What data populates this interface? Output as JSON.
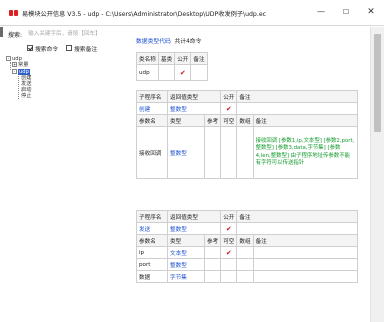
{
  "window": {
    "title": "易模块公开信息 V3.5 - udp - C:\\Users\\Administrator\\Desktop\\UDP收发例子\\udp.ec",
    "minimize": "—",
    "maximize": "☐",
    "close": "✕"
  },
  "search": {
    "label": "搜索:",
    "placeholder": "输入关键字后，请按【回车】"
  },
  "options": {
    "search_commands": "搜索命令",
    "search_comments": "搜索备注"
  },
  "tree": {
    "root": "udp",
    "child": "常量",
    "selected": "udp",
    "items": [
      "创建",
      "发送",
      "启动",
      "停止"
    ]
  },
  "summary": {
    "link": "数据类型代码",
    "count": "共计4命令"
  },
  "class_table": {
    "headers": [
      "类名称",
      "基类",
      "公开",
      "备注"
    ],
    "row": {
      "name": "udp",
      "base": "",
      "public": "✔",
      "note": ""
    }
  },
  "sub1": {
    "headers": [
      "子程序名",
      "返回值类型",
      "公开",
      "备注"
    ],
    "row": {
      "name": "创建",
      "return_type": "整数型",
      "public": "✔",
      "note": ""
    },
    "param_headers": [
      "参数名",
      "类型",
      "参考",
      "可空",
      "数组",
      "备注"
    ],
    "param_row": {
      "name": "接收回调",
      "type": "整数型",
      "note": "接收回调 [参数1,ip,文本型] [参数2,port,整数型] [参数3,data,字节集] [参数4,len,整数型] 由子程序地址传参数不能有字符可以传送指针"
    }
  },
  "sub2": {
    "headers": [
      "子程序名",
      "返回值类型",
      "公开",
      "备注"
    ],
    "row": {
      "name": "发送",
      "return_type": "整数型",
      "public": "✔",
      "note": ""
    },
    "param_headers": [
      "参数名",
      "类型",
      "参考",
      "可空",
      "数组",
      "备注"
    ],
    "params": [
      {
        "name": "ip",
        "type": "文本型",
        "nullable": "✔"
      },
      {
        "name": "port",
        "type": "整数型",
        "nullable": ""
      },
      {
        "name": "数据",
        "type": "字节集",
        "nullable": ""
      }
    ]
  },
  "colors": {
    "link": "#1a4fd0",
    "check": "#cc1a1a",
    "note_green": "#139b2e",
    "selection": "#2f62c8",
    "app_icon": "#e02020"
  }
}
